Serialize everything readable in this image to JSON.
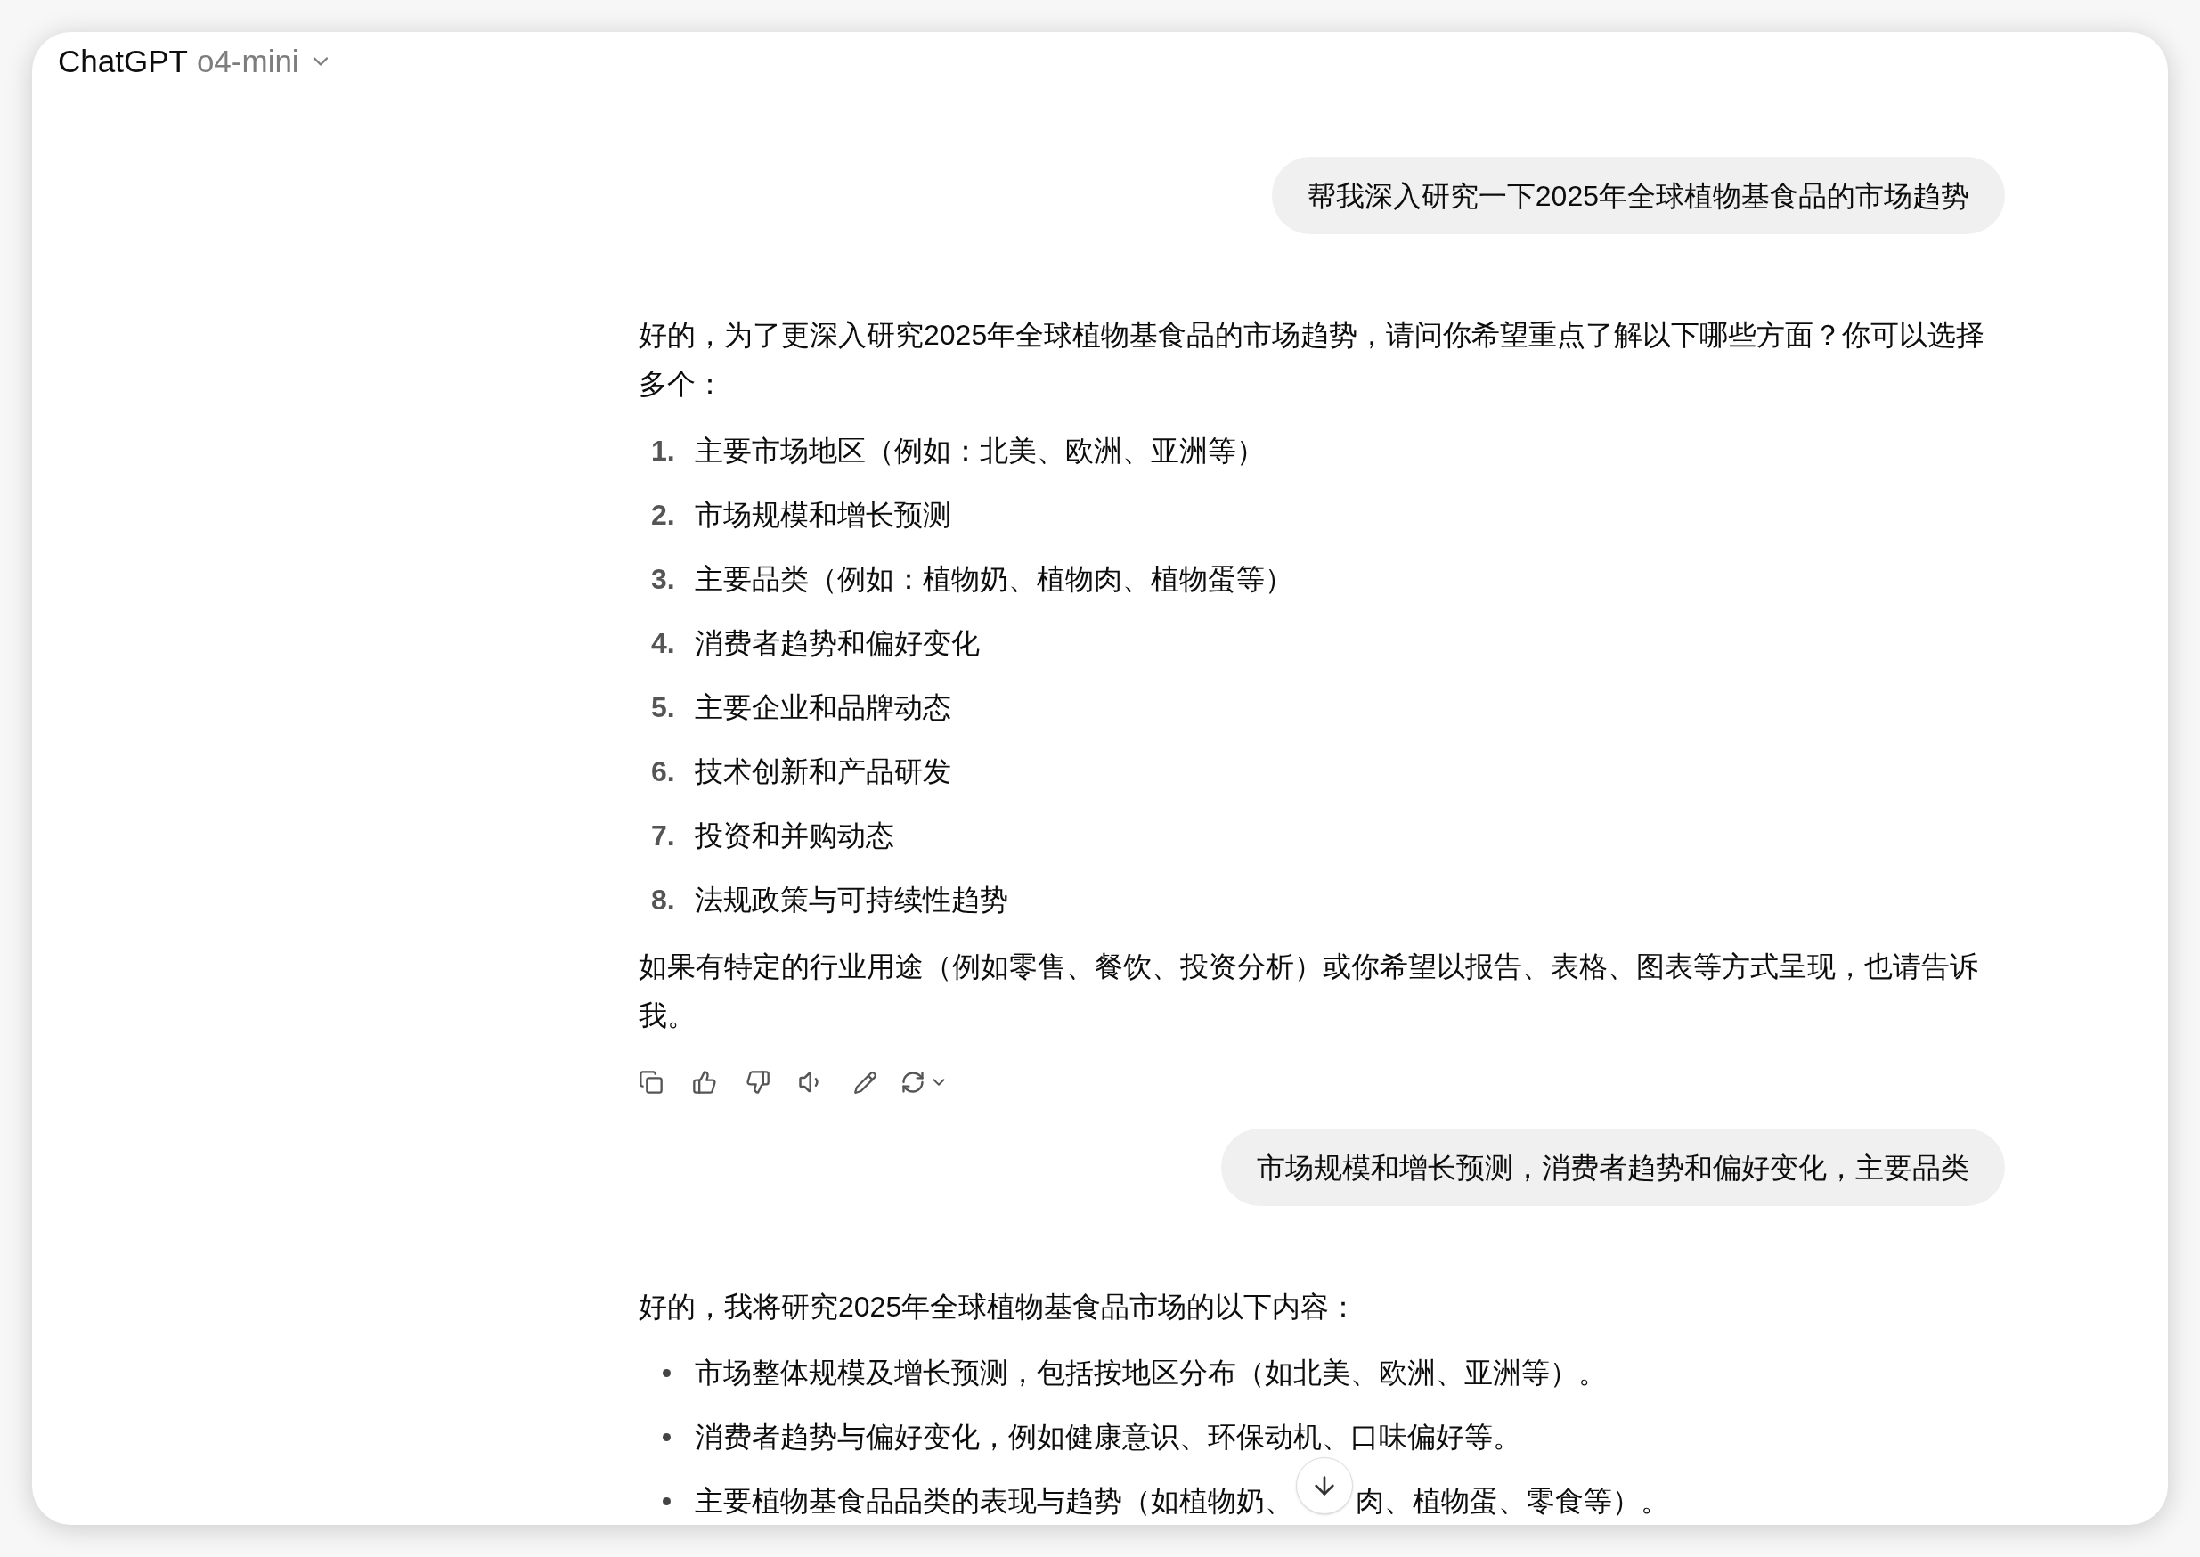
{
  "header": {
    "title": "ChatGPT",
    "model": "o4-mini"
  },
  "messages": [
    {
      "kind": "user",
      "text": "帮我深入研究一下2025年全球植物基食品的市场趋势"
    },
    {
      "kind": "assistant",
      "actions": true,
      "blocks": [
        {
          "kind": "paragraph",
          "text": "好的，为了更深入研究2025年全球植物基食品的市场趋势，请问你希望重点了解以下哪些方面？你可以选择多个："
        },
        {
          "kind": "numbered",
          "items": [
            {
              "number": "1.",
              "text": "主要市场地区（例如：北美、欧洲、亚洲等）"
            },
            {
              "number": "2.",
              "text": "市场规模和增长预测"
            },
            {
              "number": "3.",
              "text": "主要品类（例如：植物奶、植物肉、植物蛋等）"
            },
            {
              "number": "4.",
              "text": "消费者趋势和偏好变化"
            },
            {
              "number": "5.",
              "text": "主要企业和品牌动态"
            },
            {
              "number": "6.",
              "text": "技术创新和产品研发"
            },
            {
              "number": "7.",
              "text": "投资和并购动态"
            },
            {
              "number": "8.",
              "text": "法规政策与可持续性趋势"
            }
          ]
        },
        {
          "kind": "paragraph",
          "text": "如果有特定的行业用途（例如零售、餐饮、投资分析）或你希望以报告、表格、图表等方式呈现，也请告诉我。"
        }
      ]
    },
    {
      "kind": "user",
      "text": "市场规模和增长预测，消费者趋势和偏好变化，主要品类"
    },
    {
      "kind": "assistant",
      "actions": false,
      "blocks": [
        {
          "kind": "paragraph",
          "text": "好的，我将研究2025年全球植物基食品市场的以下内容："
        },
        {
          "kind": "bulleted",
          "items": [
            {
              "text": "市场整体规模及增长预测，包括按地区分布（如北美、欧洲、亚洲等）。"
            },
            {
              "text": "消费者趋势与偏好变化，例如健康意识、环保动机、口味偏好等。"
            },
            {
              "text": "主要植物基食品品类的表现与趋势（如植物奶、",
              "text_after": "肉、植物蛋、零食等）。"
            }
          ]
        }
      ]
    }
  ]
}
